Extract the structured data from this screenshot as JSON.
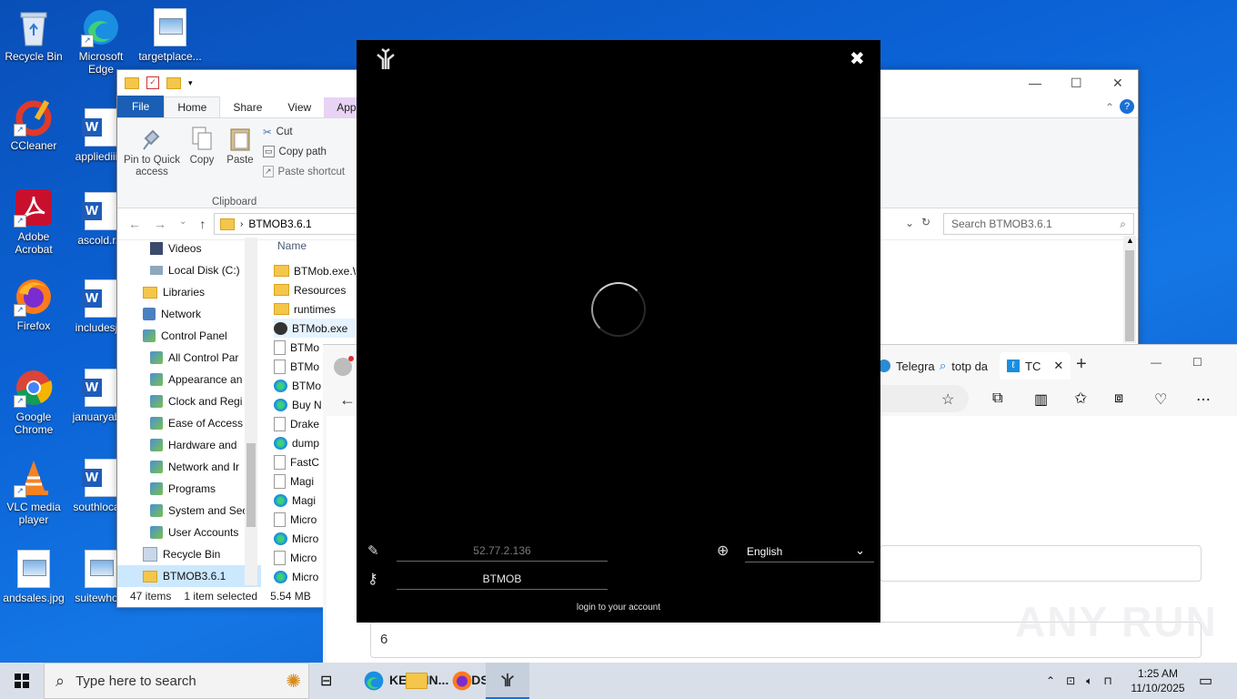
{
  "desktop": {
    "icons": [
      {
        "label": "Recycle Bin"
      },
      {
        "label": "Microsoft Edge"
      },
      {
        "label": "targetplace..."
      },
      {
        "label": "CCleaner"
      },
      {
        "label": "appliediii..."
      },
      {
        "label": "Adobe Acrobat"
      },
      {
        "label": "ascold.r..."
      },
      {
        "label": "Firefox"
      },
      {
        "label": "includesj..."
      },
      {
        "label": "Google Chrome"
      },
      {
        "label": "januaryab..."
      },
      {
        "label": "VLC media player"
      },
      {
        "label": "southloca..."
      },
      {
        "label": "andsales.jpg"
      },
      {
        "label": "suitewho..."
      }
    ]
  },
  "explorer": {
    "tabs": [
      "File",
      "Home",
      "Share",
      "View",
      "App"
    ],
    "ribbon": {
      "pin_label": "Pin to Quick access",
      "copy_label": "Copy",
      "paste_label": "Paste",
      "cut_label": "Cut",
      "copy_path_label": "Copy path",
      "paste_shortcut_label": "Paste shortcut",
      "group_label": "Clipboard"
    },
    "address": "BTMOB3.6.1",
    "search_placeholder": "Search BTMOB3.6.1",
    "column_name": "Name",
    "nav_items": [
      {
        "label": "Videos",
        "sel": false
      },
      {
        "label": "Local Disk (C:)",
        "sel": false
      },
      {
        "label": "Libraries",
        "sel": false
      },
      {
        "label": "Network",
        "sel": false
      },
      {
        "label": "Control Panel",
        "sel": false
      },
      {
        "label": "All Control Par",
        "sel": false
      },
      {
        "label": "Appearance an",
        "sel": false
      },
      {
        "label": "Clock and Regi",
        "sel": false
      },
      {
        "label": "Ease of Access",
        "sel": false
      },
      {
        "label": "Hardware and",
        "sel": false
      },
      {
        "label": "Network and Ir",
        "sel": false
      },
      {
        "label": "Programs",
        "sel": false
      },
      {
        "label": "System and Sec",
        "sel": false
      },
      {
        "label": "User Accounts",
        "sel": false
      },
      {
        "label": "Recycle Bin",
        "sel": false
      },
      {
        "label": "BTMOB3.6.1",
        "sel": true
      }
    ],
    "files": [
      {
        "label": "BTMob.exe.W",
        "icon": "folder"
      },
      {
        "label": "Resources",
        "icon": "folder"
      },
      {
        "label": "runtimes",
        "icon": "folder"
      },
      {
        "label": "BTMob.exe",
        "icon": "app",
        "sel": true
      },
      {
        "label": "BTMo",
        "icon": "doc"
      },
      {
        "label": "BTMo",
        "icon": "doc"
      },
      {
        "label": "BTMo",
        "icon": "edge"
      },
      {
        "label": "Buy N",
        "icon": "edge"
      },
      {
        "label": "Drake",
        "icon": "doc"
      },
      {
        "label": "dump",
        "icon": "edge"
      },
      {
        "label": "FastC",
        "icon": "doc"
      },
      {
        "label": "Magi",
        "icon": "doc"
      },
      {
        "label": "Magi",
        "icon": "edge"
      },
      {
        "label": "Micro",
        "icon": "doc"
      },
      {
        "label": "Micro",
        "icon": "edge"
      },
      {
        "label": "Micro",
        "icon": "doc"
      },
      {
        "label": "Micro",
        "icon": "edge"
      }
    ],
    "status": {
      "items": "47 items",
      "selected": "1 item selected",
      "size": "5.54 MB"
    }
  },
  "edge": {
    "tabs": [
      "Telegra",
      "totp da",
      "TC"
    ],
    "field_value": "6"
  },
  "btmob": {
    "server_value": "52.77.2.136",
    "key_value": "BTMOB",
    "language": "English",
    "login_link": "login to your account",
    "close_label": "✖"
  },
  "taskbar": {
    "search_placeholder": "Type here to search",
    "title_text": "KE... (IN... ONDS)",
    "time": "1:25 AM",
    "date": "11/10/2025"
  },
  "watermark": "ANY RUN",
  "colors": {
    "explorer_file_tab": "#1a5fb4",
    "btmob_bg": "#000000",
    "desktop_bg": "#0b63d6",
    "selection": "#cce8ff"
  }
}
